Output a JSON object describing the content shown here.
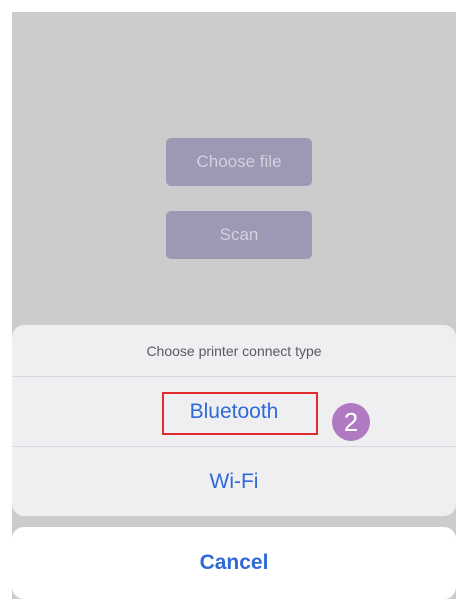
{
  "background_buttons": {
    "choose_file": "Choose file",
    "scan": "Scan"
  },
  "action_sheet": {
    "title": "Choose printer connect type",
    "options": [
      {
        "label": "Bluetooth"
      },
      {
        "label": "Wi-Fi"
      }
    ],
    "cancel_label": "Cancel"
  },
  "annotation": {
    "step_number": "2",
    "highlight_color": "#e02b2b",
    "badge_color": "#b07ac2"
  },
  "colors": {
    "accent": "#2f6ad6",
    "overlay_background": "#cccccc",
    "button_fill": "#9b99b4"
  }
}
